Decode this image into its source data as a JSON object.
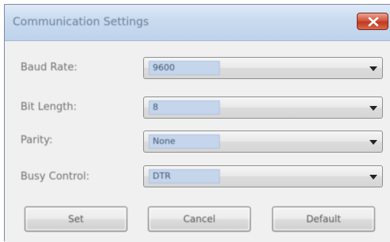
{
  "window": {
    "title": "Communication Settings",
    "close_icon": "close-x-icon"
  },
  "fields": [
    {
      "label": "Baud Rate:",
      "value": "9600"
    },
    {
      "label": "Bit Length:",
      "value": "8"
    },
    {
      "label": "Parity:",
      "value": "None"
    },
    {
      "label": "Busy Control:",
      "value": "DTR"
    }
  ],
  "buttons": {
    "set_label": "Set",
    "cancel_label": "Cancel",
    "default_label": "Default"
  },
  "colors": {
    "close_button": "#c7432a",
    "selection_highlight": "#c5d6ec"
  }
}
